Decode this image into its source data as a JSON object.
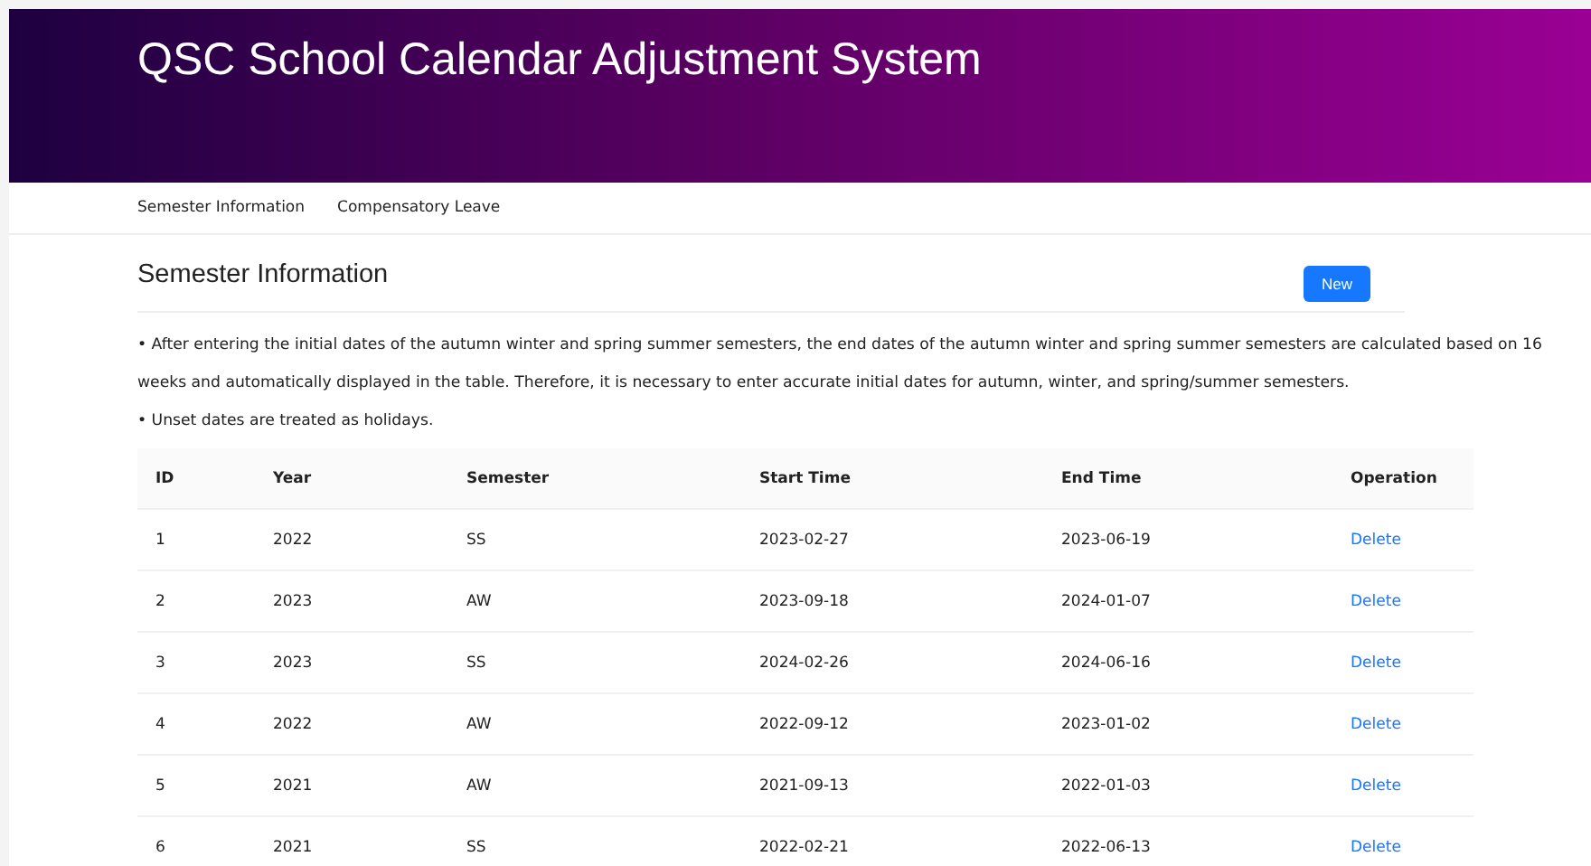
{
  "header": {
    "title": "QSC School Calendar Adjustment System"
  },
  "nav": {
    "items": [
      "Semester Information",
      "Compensatory Leave"
    ]
  },
  "section": {
    "title": "Semester Information",
    "new_button": "New",
    "notes": [
      "• After entering the initial dates of the autumn winter and spring summer semesters, the end dates of the autumn winter and spring summer semesters are calculated based on 16 weeks and automatically displayed in the table. Therefore, it is necessary to enter accurate initial dates for autumn, winter, and spring/summer semesters.",
      "• Unset dates are treated as holidays."
    ]
  },
  "table": {
    "columns": [
      "ID",
      "Year",
      "Semester",
      "Start Time",
      "End Time",
      "Operation"
    ],
    "rows": [
      {
        "cells": [
          "1",
          "2022",
          "SS",
          "2023-02-27",
          "2023-06-19"
        ],
        "action": "Delete"
      },
      {
        "cells": [
          "2",
          "2023",
          "AW",
          "2023-09-18",
          "2024-01-07"
        ],
        "action": "Delete"
      },
      {
        "cells": [
          "3",
          "2023",
          "SS",
          "2024-02-26",
          "2024-06-16"
        ],
        "action": "Delete"
      },
      {
        "cells": [
          "4",
          "2022",
          "AW",
          "2022-09-12",
          "2023-01-02"
        ],
        "action": "Delete"
      },
      {
        "cells": [
          "5",
          "2021",
          "AW",
          "2021-09-13",
          "2022-01-03"
        ],
        "action": "Delete"
      },
      {
        "cells": [
          "6",
          "2021",
          "SS",
          "2022-02-21",
          "2022-06-13"
        ],
        "action": "Delete"
      }
    ]
  }
}
